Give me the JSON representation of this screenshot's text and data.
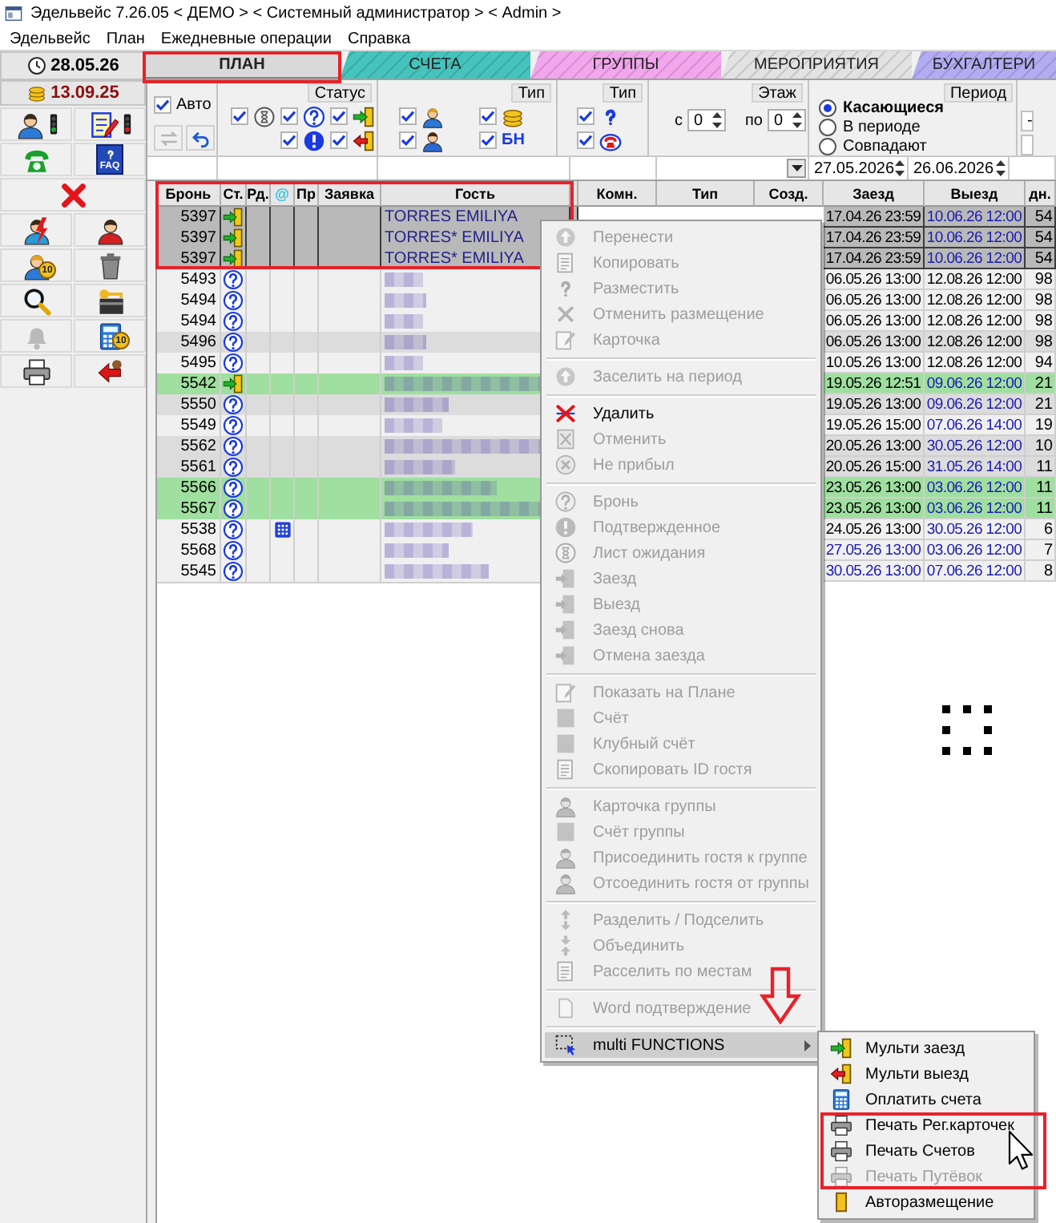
{
  "window": {
    "title": "Эдельвейс 7.26.05 < ДЕМО > < Системный администратор > < Admin >"
  },
  "menu_bar": [
    "Эдельвейс",
    "План",
    "Ежедневные операции",
    "Справка"
  ],
  "left_panel": {
    "current_date": "28.05.26",
    "system_date": "13.09.25",
    "tools": [
      {
        "disabled": false,
        "color": "#1fa83a"
      },
      {
        "disabled": false,
        "color": "#d9211f"
      },
      {
        "disabled": false
      },
      {
        "disabled": false,
        "label": "FAQ"
      },
      {
        "disabled": false
      },
      {
        "disabled": false
      },
      {
        "disabled": false
      },
      {
        "disabled": false,
        "badge": "10"
      },
      {
        "disabled": false
      },
      {
        "disabled": false
      },
      {
        "disabled": false
      },
      {
        "disabled": true
      },
      {
        "disabled": false,
        "badge": "10"
      },
      {
        "disabled": false
      },
      {
        "disabled": false
      }
    ]
  },
  "tabs": [
    {
      "label": "ПЛАН",
      "selected": true,
      "color": "#d9d9d9"
    },
    {
      "label": "СЧЕТА",
      "selected": false,
      "color": "#45c3bd"
    },
    {
      "label": "ГРУППЫ",
      "selected": false,
      "color": "#f2a6ec"
    },
    {
      "label": "МЕРОПРИЯТИЯ",
      "selected": false,
      "color": "#e2e2e2"
    },
    {
      "label": "БУХГАЛТЕРИ",
      "selected": false,
      "color": "#b4acf2"
    }
  ],
  "filters": {
    "auto": {
      "label": "Авто",
      "checked": true
    },
    "auto_buttons": [
      {
        "disabled": true
      },
      {
        "disabled": false
      }
    ],
    "status": {
      "title": "Статус",
      "options": [
        {
          "checked": true
        },
        {
          "checked": true
        },
        {
          "checked": true
        },
        {
          "checked": true
        },
        {
          "checked": true
        }
      ]
    },
    "type_groups": [
      {
        "title": "Тип",
        "options": [
          {
            "checked": true
          },
          {
            "checked": true
          },
          {
            "checked": true
          },
          {
            "checked": true,
            "label": "БН"
          }
        ]
      },
      {
        "title": "Тип",
        "options": [
          {
            "checked": true
          },
          {
            "checked": true
          }
        ]
      }
    ],
    "floor": {
      "title": "Этаж",
      "from_label": "с",
      "from_value": "0",
      "to_label": "по",
      "to_value": "0"
    },
    "period": {
      "title": "Период",
      "options": [
        {
          "label": "Касающиеся",
          "selected": true
        },
        {
          "label": "В периоде",
          "selected": false
        },
        {
          "label": "Совпадают",
          "selected": false
        }
      ],
      "date_from": "27.05.2026",
      "date_to": "26.06.2026"
    },
    "extra_value": "-"
  },
  "table": {
    "columns": [
      "Бронь",
      "Ст.",
      "Рд.",
      "@",
      "Пр",
      "Заявка",
      "Гость",
      "Комн.",
      "Тип",
      "Созд.",
      "Заезд",
      "Выезд",
      "дн."
    ],
    "rows": [
      {
        "booking": "5397",
        "checked_in": true,
        "selected": true,
        "color": "#b9b9b9",
        "guest": "TORRES EMILIYA",
        "at_flag": false,
        "arrival": "17.04.26 23:59",
        "arrival_emphasis": false,
        "departure": "10.06.26 12:00",
        "departure_emphasis": true,
        "days": "54"
      },
      {
        "booking": "5397",
        "checked_in": true,
        "selected": true,
        "color": "#b9b9b9",
        "guest": "TORRES* EMILIYA",
        "at_flag": false,
        "arrival": "17.04.26 23:59",
        "arrival_emphasis": false,
        "departure": "10.06.26 12:00",
        "departure_emphasis": true,
        "days": "54"
      },
      {
        "booking": "5397",
        "checked_in": true,
        "selected": true,
        "color": "#b9b9b9",
        "guest": "TORRES* EMILIYA",
        "at_flag": false,
        "arrival": "17.04.26 23:59",
        "arrival_emphasis": false,
        "departure": "10.06.26 12:00",
        "departure_emphasis": true,
        "days": "54"
      },
      {
        "booking": "5493",
        "checked_in": false,
        "selected": false,
        "color": "#f0f0f0",
        "at_flag": false,
        "arrival": "06.05.26 13:00",
        "arrival_emphasis": false,
        "departure": "12.08.26 12:00",
        "departure_emphasis": false,
        "days": "98"
      },
      {
        "booking": "5494",
        "checked_in": false,
        "selected": false,
        "color": "#f0f0f0",
        "at_flag": false,
        "arrival": "06.05.26 13:00",
        "arrival_emphasis": false,
        "departure": "12.08.26 12:00",
        "departure_emphasis": false,
        "days": "98"
      },
      {
        "booking": "5494",
        "checked_in": false,
        "selected": false,
        "color": "#f0f0f0",
        "at_flag": false,
        "arrival": "06.05.26 13:00",
        "arrival_emphasis": false,
        "departure": "12.08.26 12:00",
        "departure_emphasis": false,
        "days": "98"
      },
      {
        "booking": "5496",
        "checked_in": false,
        "selected": false,
        "color": "#dcdcdc",
        "at_flag": false,
        "arrival": "06.05.26 13:00",
        "arrival_emphasis": false,
        "departure": "12.08.26 12:00",
        "departure_emphasis": false,
        "days": "98"
      },
      {
        "booking": "5495",
        "checked_in": false,
        "selected": false,
        "color": "#f0f0f0",
        "at_flag": false,
        "arrival": "10.05.26 13:00",
        "arrival_emphasis": false,
        "departure": "12.08.26 12:00",
        "departure_emphasis": false,
        "days": "94"
      },
      {
        "booking": "5542",
        "checked_in": true,
        "selected": false,
        "color": "#9fdf9f",
        "at_flag": false,
        "arrival": "19.05.26 12:51",
        "arrival_emphasis": false,
        "departure": "09.06.26 12:00",
        "departure_emphasis": true,
        "days": "21"
      },
      {
        "booking": "5550",
        "checked_in": false,
        "selected": false,
        "color": "#dcdcdc",
        "at_flag": false,
        "arrival": "19.05.26 13:00",
        "arrival_emphasis": false,
        "departure": "09.06.26 12:00",
        "departure_emphasis": true,
        "days": "21"
      },
      {
        "booking": "5549",
        "checked_in": false,
        "selected": false,
        "color": "#f0f0f0",
        "at_flag": false,
        "arrival": "19.05.26 15:00",
        "arrival_emphasis": false,
        "departure": "07.06.26 14:00",
        "departure_emphasis": true,
        "days": "19"
      },
      {
        "booking": "5562",
        "checked_in": false,
        "selected": false,
        "color": "#dcdcdc",
        "at_flag": false,
        "arrival": "20.05.26 13:00",
        "arrival_emphasis": false,
        "departure": "30.05.26 12:00",
        "departure_emphasis": true,
        "days": "10"
      },
      {
        "booking": "5561",
        "checked_in": false,
        "selected": false,
        "color": "#dcdcdc",
        "at_flag": false,
        "arrival": "20.05.26 15:00",
        "arrival_emphasis": false,
        "departure": "31.05.26 14:00",
        "departure_emphasis": true,
        "days": "11"
      },
      {
        "booking": "5566",
        "checked_in": false,
        "selected": false,
        "color": "#9fdf9f",
        "at_flag": false,
        "arrival": "23.05.26 13:00",
        "arrival_emphasis": false,
        "departure": "03.06.26 12:00",
        "departure_emphasis": true,
        "days": "11"
      },
      {
        "booking": "5567",
        "checked_in": false,
        "selected": false,
        "color": "#9fdf9f",
        "at_flag": false,
        "arrival": "23.05.26 13:00",
        "arrival_emphasis": false,
        "departure": "03.06.26 12:00",
        "departure_emphasis": true,
        "days": "11"
      },
      {
        "booking": "5538",
        "checked_in": false,
        "selected": false,
        "color": "#f0f0f0",
        "at_flag": true,
        "arrival": "24.05.26 13:00",
        "arrival_emphasis": false,
        "departure": "30.05.26 12:00",
        "departure_emphasis": true,
        "days": "6"
      },
      {
        "booking": "5568",
        "checked_in": false,
        "selected": false,
        "color": "#f0f0f0",
        "at_flag": false,
        "arrival": "27.05.26 13:00",
        "arrival_emphasis": true,
        "departure": "03.06.26 12:00",
        "departure_emphasis": true,
        "days": "7"
      },
      {
        "booking": "5545",
        "checked_in": false,
        "selected": false,
        "color": "#f0f0f0",
        "at_flag": false,
        "arrival": "30.05.26 13:00",
        "arrival_emphasis": true,
        "departure": "07.06.26 12:00",
        "departure_emphasis": true,
        "days": "8"
      }
    ]
  },
  "context_menu": {
    "groups": [
      [
        {
          "label": "Перенести",
          "disabled": true,
          "selected": false
        },
        {
          "label": "Копировать",
          "disabled": true,
          "selected": false
        },
        {
          "label": "Разместить",
          "disabled": true,
          "selected": false
        },
        {
          "label": "Отменить размещение",
          "disabled": true,
          "selected": false
        },
        {
          "label": "Карточка",
          "disabled": true,
          "selected": false
        }
      ],
      [
        {
          "label": "Заселить на период",
          "disabled": true,
          "selected": false
        }
      ],
      [
        {
          "label": "Удалить",
          "disabled": false,
          "selected": false
        },
        {
          "label": "Отменить",
          "disabled": true,
          "selected": false
        },
        {
          "label": "Не прибыл",
          "disabled": true,
          "selected": false
        }
      ],
      [
        {
          "label": "Бронь",
          "disabled": true,
          "selected": false
        },
        {
          "label": "Подтвержденное",
          "disabled": true,
          "selected": false
        },
        {
          "label": "Лист ожидания",
          "disabled": true,
          "selected": false
        },
        {
          "label": "Заезд",
          "disabled": true,
          "selected": false
        },
        {
          "label": "Выезд",
          "disabled": true,
          "selected": false
        },
        {
          "label": "Заезд снова",
          "disabled": true,
          "selected": false
        },
        {
          "label": "Отмена заезда",
          "disabled": true,
          "selected": false
        }
      ],
      [
        {
          "label": "Показать на Плане",
          "disabled": true,
          "selected": false
        },
        {
          "label": "Счёт",
          "disabled": true,
          "selected": false
        },
        {
          "label": "Клубный счёт",
          "disabled": true,
          "selected": false
        },
        {
          "label": "Скопировать ID гостя",
          "disabled": true,
          "selected": false
        }
      ],
      [
        {
          "label": "Карточка группы",
          "disabled": true,
          "selected": false
        },
        {
          "label": "Счёт группы",
          "disabled": true,
          "selected": false
        },
        {
          "label": "Присоединить гостя к группе",
          "disabled": true,
          "selected": false
        },
        {
          "label": "Отсоединить гостя от группы",
          "disabled": true,
          "selected": false
        }
      ],
      [
        {
          "label": "Разделить / Подселить",
          "disabled": true,
          "selected": false
        },
        {
          "label": "Объединить",
          "disabled": true,
          "selected": false
        },
        {
          "label": "Расселить по местам",
          "disabled": true,
          "selected": false
        }
      ],
      [
        {
          "label": "Word подтверждение",
          "disabled": true,
          "selected": false
        }
      ],
      [
        {
          "label": "multi FUNCTIONS",
          "disabled": false,
          "selected": true,
          "submenu": [
            {
              "label": "Мульти заезд",
              "disabled": false
            },
            {
              "label": "Мульти выезд",
              "disabled": false
            },
            {
              "label": "Оплатить счета",
              "disabled": false
            },
            {
              "label": "Печать Рег.карточек",
              "disabled": false
            },
            {
              "label": "Печать Счетов",
              "disabled": false
            },
            {
              "label": "Печать Путёвок",
              "disabled": true
            },
            {
              "label": "Авторазмещение",
              "disabled": false
            }
          ]
        }
      ]
    ]
  }
}
